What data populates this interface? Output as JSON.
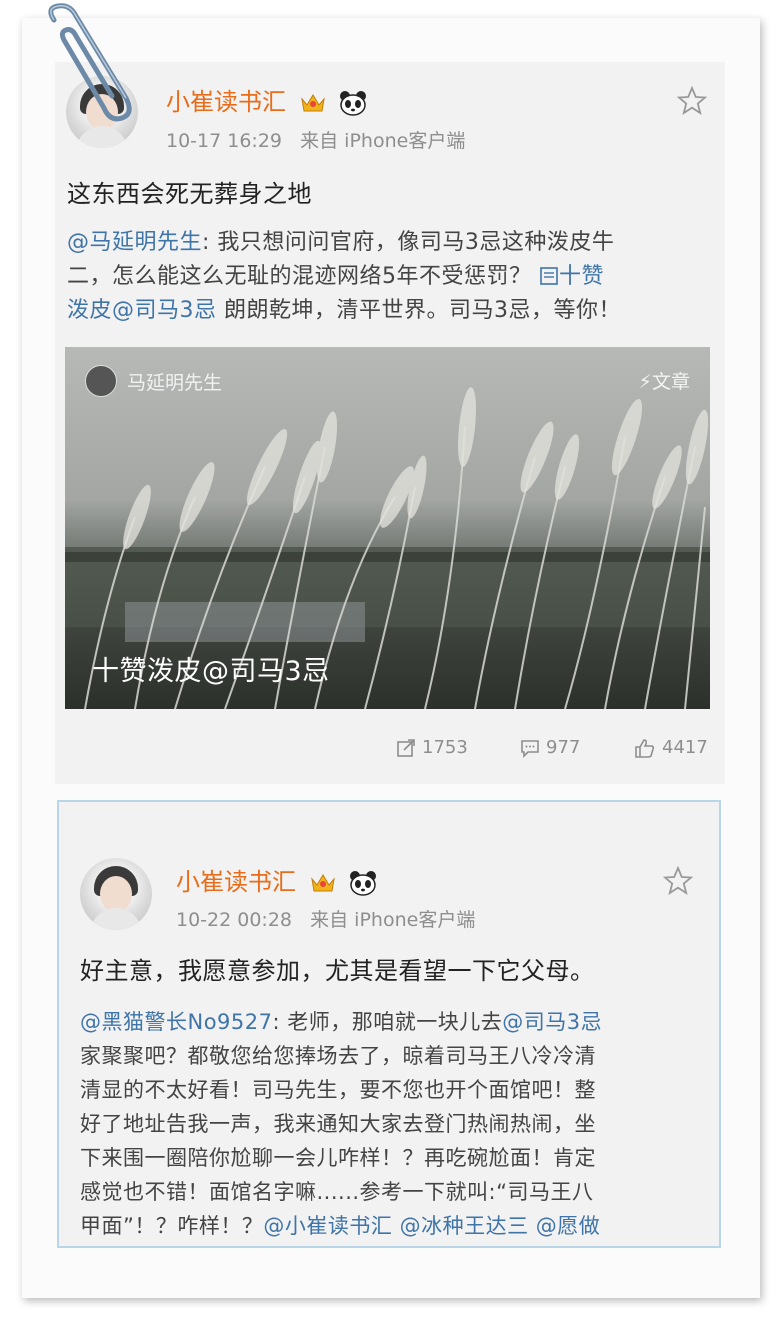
{
  "post1": {
    "username": "小崔读书汇",
    "timestamp": "10-17 16:29",
    "source": "来自 iPhone客户端",
    "text": "这东西会死无葬身之地",
    "repost": {
      "mention": "@马延明先生",
      "line1_rest": ": 我只想问问官府，像司马3忌这种泼皮牛",
      "line2_text": "二，怎么能这么无耻的混迹网络5年不受惩罚？",
      "link_text": "十赞",
      "line3_link": "泼皮@司马3忌",
      "line3_rest": " 朗朗乾坤，清平世界。司马3忌，等你！"
    },
    "media": {
      "author": "马延明先生",
      "type_label": "文章",
      "caption": "十赞泼皮@司马3忌"
    },
    "actions": {
      "repost_count": "1753",
      "comment_count": "977",
      "like_count": "4417"
    }
  },
  "post2": {
    "username": "小崔读书汇",
    "timestamp": "10-22 00:28",
    "source": "来自 iPhone客户端",
    "text": "好主意，我愿意参加，尤其是看望一下它父母。",
    "repost": {
      "mention1": "@黑猫警长No9527",
      "seg1": ": 老师，那咱就一块儿去",
      "mention2": "@司马3忌",
      "line2": "家聚聚吧？都敬您给您捧场去了，晾着司马王八冷冷清",
      "line3": "清显的不太好看！司马先生，要不您也开个面馆吧！整",
      "line4": "好了地址告我一声，我来通知大家去登门热闹热闹，坐",
      "line5": "下来围一圈陪你尬聊一会儿咋样！？再吃碗尬面！肯定",
      "line6": "感觉也不错！面馆名字嘛......参考一下就叫:“司马王八",
      "line7_text": "甲面”！？咋样！？",
      "mention3": "@小崔读书汇",
      "mention4": "@冰种王达三",
      "mention5": "@愿做"
    }
  },
  "colors": {
    "username": "#e86c1a",
    "link": "#3f74a8",
    "meta": "#8e8e8e"
  }
}
